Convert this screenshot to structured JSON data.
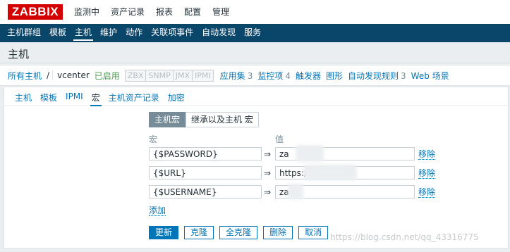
{
  "logo": "ZABBIX",
  "top_nav": [
    "监测中",
    "资产记录",
    "报表",
    "配置",
    "管理"
  ],
  "sub_nav": [
    "主机群组",
    "模板",
    "主机",
    "维护",
    "动作",
    "关联项事件",
    "自动发现",
    "服务"
  ],
  "page_title": "主机",
  "breadcrumbs": {
    "all_hosts": "所有主机",
    "sep": "/",
    "host": "vcenter",
    "status": "已启用",
    "availability": [
      "ZBX",
      "SNMP",
      "JMX",
      "IPMI"
    ],
    "links": [
      {
        "label": "应用集",
        "count": "3"
      },
      {
        "label": "监控项",
        "count": "4"
      },
      {
        "label": "触发器",
        "count": ""
      },
      {
        "label": "图形",
        "count": ""
      },
      {
        "label": "自动发现规则",
        "count": "3"
      },
      {
        "label": "Web 场景",
        "count": ""
      }
    ]
  },
  "tabs": [
    "主机",
    "模板",
    "IPMI",
    "宏",
    "主机资产记录",
    "加密"
  ],
  "macro_view": {
    "host_macros": "主机宏",
    "inherited": "继承以及主机 宏"
  },
  "columns": {
    "macro": "宏",
    "value": "值"
  },
  "macros": [
    {
      "name": "{$PASSWORD}",
      "value": "za",
      "remove": "移除"
    },
    {
      "name": "{$URL}",
      "value": "https://1                    /sdk",
      "remove": "移除"
    },
    {
      "name": "{$USERNAME}",
      "value": "za",
      "remove": "移除"
    }
  ],
  "add_label": "添加",
  "buttons": {
    "update": "更新",
    "clone": "克隆",
    "full_clone": "全克隆",
    "delete": "删除",
    "cancel": "取消"
  },
  "watermark": "https://blog.csdn.net/qq_43316775"
}
